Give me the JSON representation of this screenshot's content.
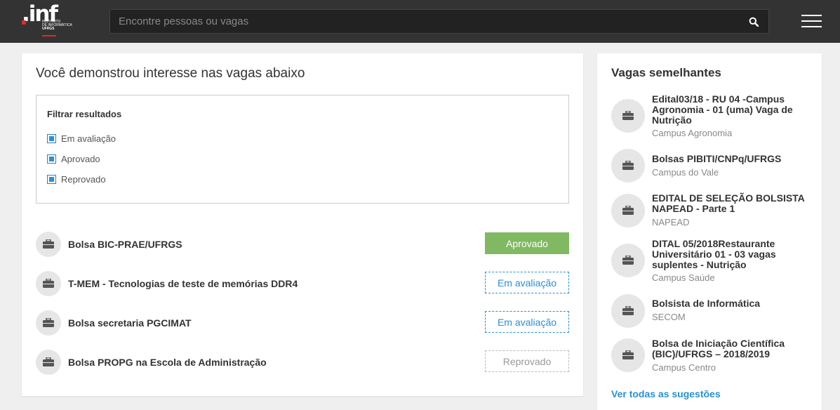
{
  "header": {
    "logo_text": ".inf",
    "logo_sub1": "INSTITUTO",
    "logo_sub2": "DE INFORMÁTICA",
    "logo_sub3": "UFRGS",
    "search_placeholder": "Encontre pessoas ou vagas"
  },
  "main": {
    "title": "Você demonstrou interesse nas vagas abaixo",
    "filter": {
      "title": "Filtrar resultados",
      "options": [
        {
          "label": "Em avaliação",
          "checked": true
        },
        {
          "label": "Aprovado",
          "checked": true
        },
        {
          "label": "Reprovado",
          "checked": true
        }
      ]
    },
    "jobs": [
      {
        "title": "Bolsa BIC-PRAE/UFRGS",
        "status": "Aprovado"
      },
      {
        "title": "T-MEM - Tecnologias de teste de memórias DDR4",
        "status": "Em avaliação"
      },
      {
        "title": "Bolsa secretaria PGCIMAT",
        "status": "Em avaliação"
      },
      {
        "title": "Bolsa PROPG na Escola de Administração",
        "status": "Reprovado"
      }
    ]
  },
  "sidebar": {
    "title": "Vagas semelhantes",
    "items": [
      {
        "title": "Edital03/18 - RU 04 -Campus Agronomia - 01 (uma) Vaga de Nutrição",
        "place": "Campus Agronomia"
      },
      {
        "title": "Bolsas PIBITI/CNPq/UFRGS",
        "place": "Campus do Vale"
      },
      {
        "title": "EDITAL DE SELEÇÃO BOLSISTA NAPEAD - Parte 1",
        "place": "NAPEAD"
      },
      {
        "title": "DITAL 05/2018Restaurante Universitário 01 - 03 vagas suplentes - Nutrição",
        "place": "Campus Saúde"
      },
      {
        "title": "Bolsista de Informática",
        "place": "SECOM"
      },
      {
        "title": "Bolsa de Iniciação Científica (BIC)/UFRGS – 2018/2019",
        "place": "Campus Centro"
      }
    ],
    "see_all": "Ver todas as sugestões"
  },
  "colors": {
    "topbar": "#333333",
    "accent_blue": "#2a8fd6",
    "approved_green": "#80b962",
    "brand_red": "#e0282d"
  }
}
